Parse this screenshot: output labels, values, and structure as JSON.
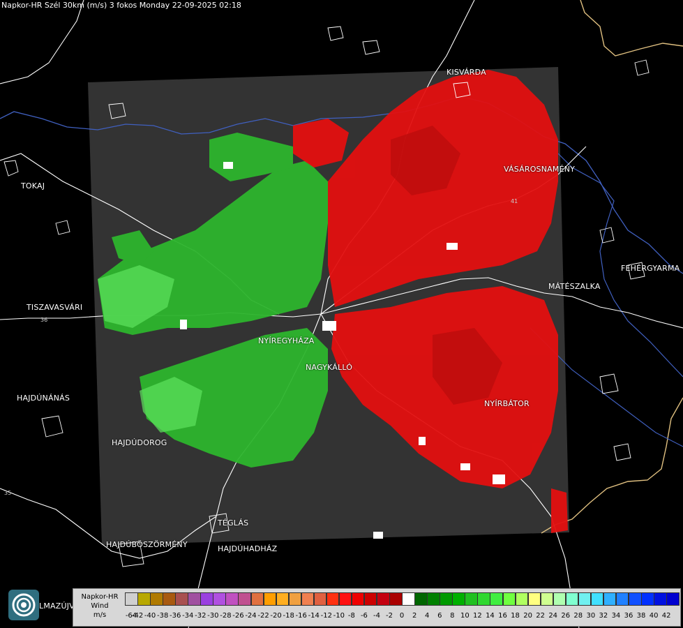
{
  "header": {
    "title": "Napkor-HR Szél 30km (m/s) 3 fokos Monday 22-09-2025 02:18"
  },
  "cities": [
    {
      "id": "kisvarda",
      "name": "KISVÁRDA"
    },
    {
      "id": "vasarosnameny",
      "name": "VÁSÁROSNAMÉNY"
    },
    {
      "id": "tokaj",
      "name": "TOKAJ"
    },
    {
      "id": "fehergyarmat",
      "name": "FEHÉRGYARMA"
    },
    {
      "id": "mateszalka",
      "name": "MÁTÉSZALKA"
    },
    {
      "id": "tiszavasvari",
      "name": "TISZAVASVÁRI"
    },
    {
      "id": "nyiregyhaza",
      "name": "NYÍREGYHÁZA"
    },
    {
      "id": "nagykallo",
      "name": "NAGYKÁLLÓ"
    },
    {
      "id": "hajdunanas",
      "name": "HAJDÚNÁNÁS"
    },
    {
      "id": "nyirbator",
      "name": "NYÍRBÁTOR"
    },
    {
      "id": "hajdudorog",
      "name": "HAJDÚDOROG"
    },
    {
      "id": "teglas",
      "name": "TÉGLÁS"
    },
    {
      "id": "hajduboszormeny",
      "name": "HAJDÚBÖSZÖRMÉNY"
    },
    {
      "id": "hajduhadhaz",
      "name": "HAJDÚHADHÁZ"
    },
    {
      "id": "almazujvaros",
      "name": "LMAZÚJVÁR"
    }
  ],
  "road_numbers": [
    "36",
    "41",
    "35"
  ],
  "legend": {
    "line1": "Napkor-HR",
    "line2": "Wind",
    "line3": "m/s",
    "values": [
      "-64",
      "-42",
      "-40",
      "-38",
      "-36",
      "-34",
      "-32",
      "-30",
      "-28",
      "-26",
      "-24",
      "-22",
      "-20",
      "-18",
      "-16",
      "-14",
      "-12",
      "-10",
      "-8",
      "-6",
      "-4",
      "-2",
      "0",
      "2",
      "4",
      "6",
      "8",
      "10",
      "12",
      "14",
      "16",
      "18",
      "20",
      "22",
      "24",
      "26",
      "28",
      "30",
      "32",
      "34",
      "36",
      "38",
      "40",
      "42"
    ],
    "colors": [
      "#cfcfcf",
      "#b8a800",
      "#b07a00",
      "#a85a10",
      "#a85050",
      "#a050a0",
      "#9a40e0",
      "#b050e0",
      "#c050c0",
      "#c05090",
      "#e07040",
      "#ff9e00",
      "#ffae20",
      "#f0a040",
      "#f08050",
      "#e06040",
      "#ff3010",
      "#ff1010",
      "#ee0000",
      "#cc0000",
      "#c40010",
      "#aa0000",
      "#ffffff",
      "#006600",
      "#008000",
      "#009a00",
      "#00b000",
      "#20c020",
      "#30d830",
      "#40ee40",
      "#70ff40",
      "#b0ff60",
      "#ffff80",
      "#d0ff90",
      "#b0ffb0",
      "#80ffd0",
      "#70f0f0",
      "#40e0ff",
      "#30b0ff",
      "#2080ff",
      "#1050ff",
      "#0030ff",
      "#0010e0",
      "#0000d0"
    ]
  },
  "map": {
    "radar_area_color": "#333333",
    "inbound_color": "#22b822",
    "outbound_color": "#e01010",
    "boundary_color": "#ffffff",
    "river_color": "#4060c0",
    "border_color": "#e0c080"
  }
}
